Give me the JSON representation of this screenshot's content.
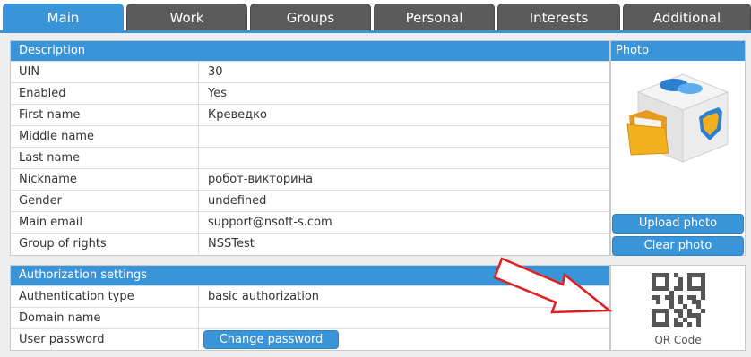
{
  "tabs": [
    {
      "label": "Main",
      "active": true
    },
    {
      "label": "Work",
      "active": false
    },
    {
      "label": "Groups",
      "active": false
    },
    {
      "label": "Personal",
      "active": false
    },
    {
      "label": "Interests",
      "active": false
    },
    {
      "label": "Additional",
      "active": false
    }
  ],
  "description": {
    "header": "Description",
    "rows": [
      {
        "label": "UIN",
        "value": "30"
      },
      {
        "label": "Enabled",
        "value": "Yes"
      },
      {
        "label": "First name",
        "value": "Креведко"
      },
      {
        "label": "Middle name",
        "value": ""
      },
      {
        "label": "Last name",
        "value": ""
      },
      {
        "label": "Nickname",
        "value": "робот-викторина"
      },
      {
        "label": "Gender",
        "value": "undefined"
      },
      {
        "label": "Main email",
        "value": "support@nsoft-s.com"
      },
      {
        "label": "Group of rights",
        "value": "NSSTest"
      }
    ]
  },
  "photo": {
    "header": "Photo",
    "upload_label": "Upload photo",
    "clear_label": "Clear photo"
  },
  "authorization": {
    "header": "Authorization settings",
    "rows": [
      {
        "label": "Authentication type",
        "value": "basic authorization"
      },
      {
        "label": "Domain name",
        "value": ""
      },
      {
        "label": "User password",
        "value": ""
      }
    ],
    "change_password_label": "Change password"
  },
  "qr": {
    "label": "QR Code"
  },
  "colors": {
    "accent": "#3a95d8",
    "tab_inactive": "#5b5b5b",
    "arrow": "#e02020"
  }
}
